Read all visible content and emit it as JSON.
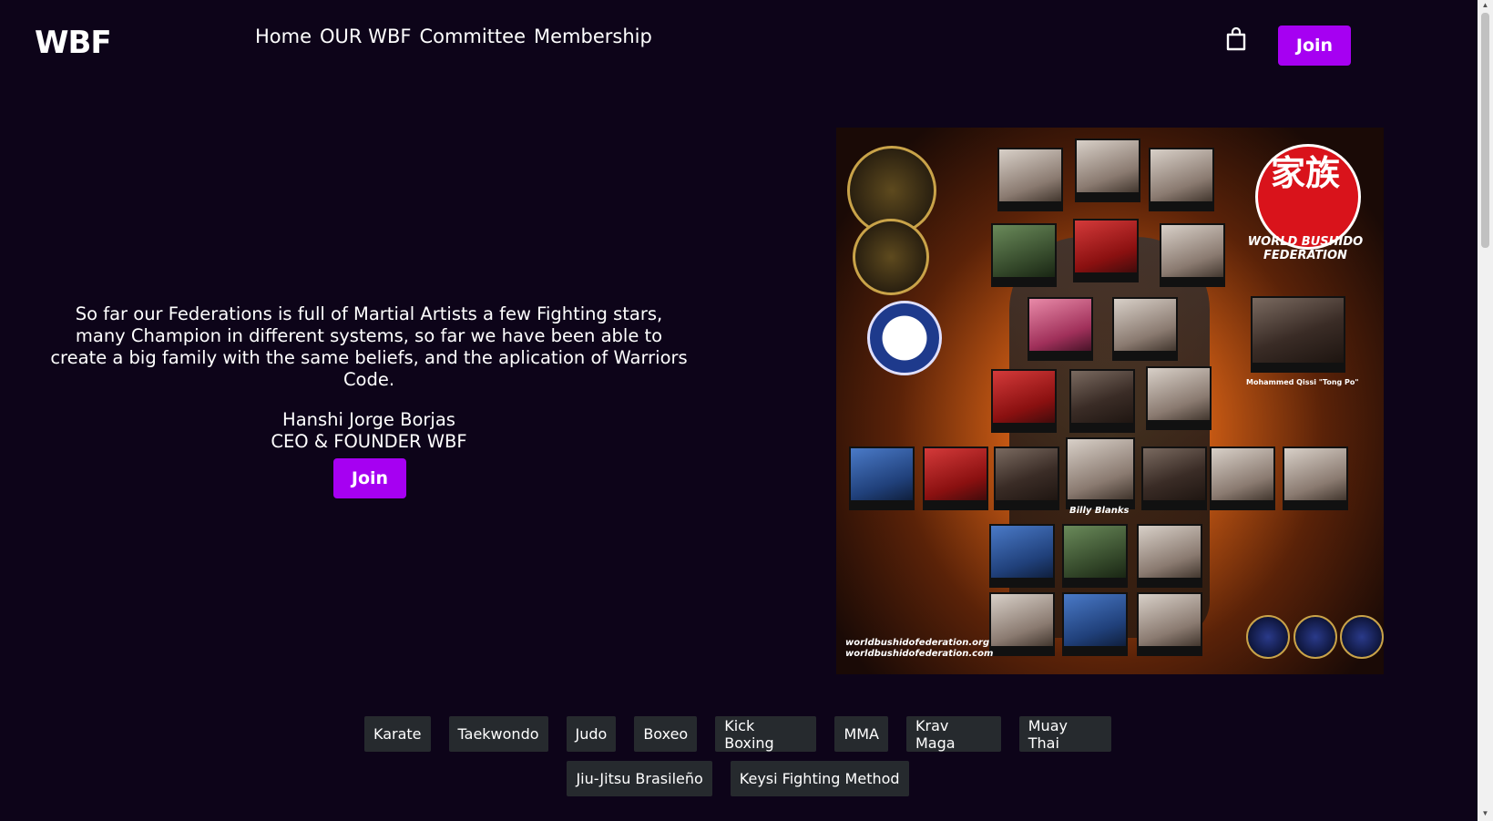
{
  "header": {
    "logo_text": "WBF",
    "nav": [
      "Home",
      "OUR WBF",
      "Committee",
      "Membership"
    ],
    "cart_icon": "shopping-bag-icon",
    "join_label": "Join"
  },
  "hero": {
    "quote": "So far our Federations is full of Martial Artists a few Fighting stars, many Champion in different systems, so far we have been able to create a big family with the same beliefs, and the aplication of Warriors Code.",
    "author_name": "Hanshi Jorge Borjas",
    "author_title": "CEO & FOUNDER WBF",
    "join_label": "Join"
  },
  "poster": {
    "kanji": "家族",
    "org_name": "WORLD BUSHIDO FEDERATION",
    "featured_label": "Billy Blanks",
    "qissi_label": "Mohammed Qissi \"Tong Po\"",
    "urls": [
      "worldbushidofederation.org",
      "worldbushidofederation.com"
    ]
  },
  "disciplines": {
    "row1": [
      "Karate",
      "Taekwondo",
      "Judo",
      "Boxeo",
      "Kick Boxing",
      "MMA",
      "Krav Maga",
      "Muay Thai"
    ],
    "row2": [
      "Jiu-Jitsu Brasileño",
      "Keysi Fighting Method"
    ]
  },
  "colors": {
    "background": "#0d0419",
    "accent": "#a600f2",
    "tag_bg": "#262a2e"
  }
}
